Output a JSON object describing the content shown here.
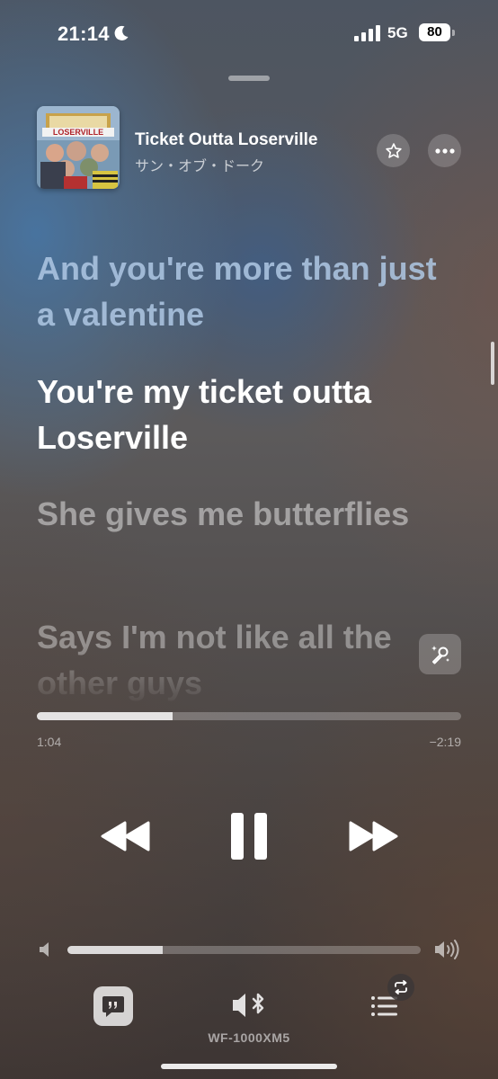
{
  "status_bar": {
    "time": "21:14",
    "network": "5G",
    "battery": "80",
    "icons": [
      "moon-icon",
      "signal-icon",
      "battery-icon"
    ]
  },
  "now_playing": {
    "title": "Ticket Outta Loserville",
    "artist": "サン・オブ・ドーク",
    "album_art_text": "LOSERVILLE",
    "icons": [
      "star-icon",
      "more-icon"
    ]
  },
  "lyrics": {
    "previous_line": "And you're more than just a valentine",
    "current_line": "You're my ticket outta Loserville",
    "next_line": "She gives me butterflies",
    "upcoming_line": "Says I'm not like all the other guys"
  },
  "playback": {
    "elapsed": "1:04",
    "remaining": "−2:19",
    "progress_fraction": 0.32,
    "state": "playing"
  },
  "volume": {
    "level_fraction": 0.27
  },
  "output": {
    "device_name": "WF-1000XM5"
  },
  "colors": {
    "accent": "#ffffff",
    "background_blue": "#4678aa",
    "background_brown": "#5f4637"
  }
}
